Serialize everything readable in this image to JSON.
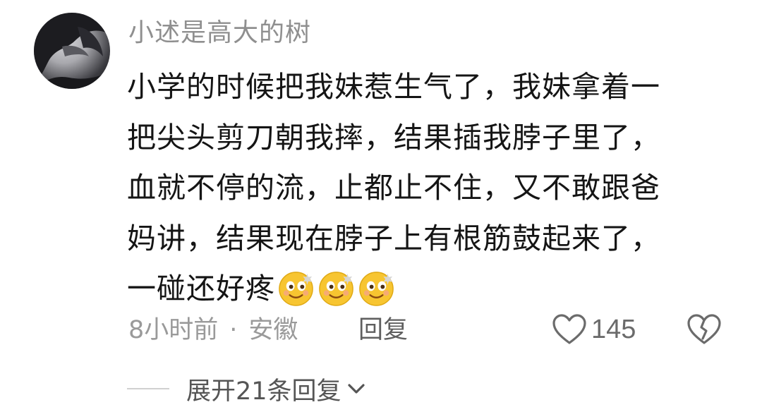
{
  "comment": {
    "username": "小述是高大的树",
    "content_lines": [
      "小学的时候把我妹惹生气了，我妹拿着一",
      "把尖头剪刀朝我摔，结果插我脖子里了，",
      "血就不停的流，止都止不住，又不敢跟爸",
      "妈讲，结果现在脖子上有根筋鼓起来了，",
      "一碰还好疼"
    ],
    "emoji_name": "dizzy-face-emoji",
    "emoji_count": 3,
    "time": "8小时前",
    "separator": "·",
    "location": "安徽",
    "reply_label": "回复",
    "like_count": "145"
  },
  "expand_replies": {
    "label": "展开21条回复"
  },
  "icons": {
    "like": "heart-outline-icon",
    "dislike": "broken-heart-icon",
    "expand": "chevron-down-icon"
  },
  "colors": {
    "username": "#8f8f8f",
    "content": "#151515",
    "meta": "#9a9a9a",
    "emoji_face": "#f7c531"
  }
}
